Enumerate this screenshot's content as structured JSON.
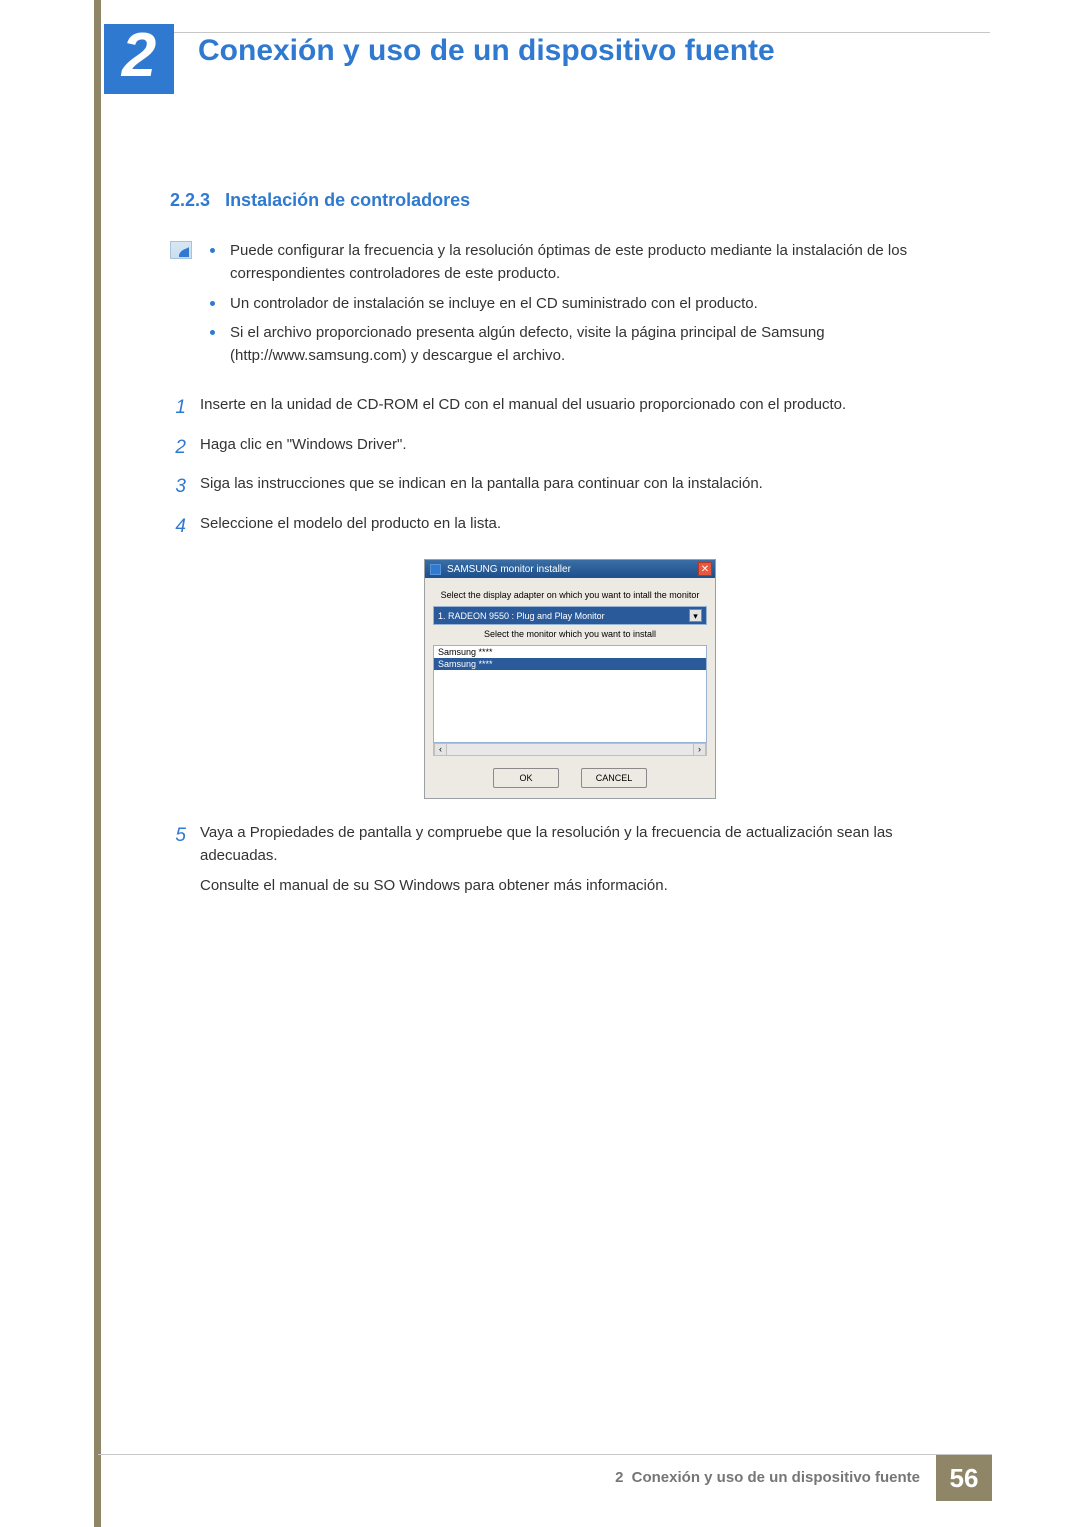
{
  "chapter": {
    "number": "2",
    "title": "Conexión y uso de un dispositivo fuente"
  },
  "section": {
    "number": "2.2.3",
    "title": "Instalación de controladores"
  },
  "notes": [
    "Puede configurar la frecuencia y la resolución óptimas de este producto mediante la instalación de los correspondientes controladores de este producto.",
    "Un controlador de instalación se incluye en el CD suministrado con el producto.",
    "Si el archivo proporcionado presenta algún defecto, visite la página principal de Samsung (http://www.samsung.com) y descargue el archivo."
  ],
  "steps": [
    {
      "n": "1",
      "text": "Inserte en la unidad de CD-ROM el CD con el manual del usuario proporcionado con el producto."
    },
    {
      "n": "2",
      "text": "Haga clic en \"Windows Driver\"."
    },
    {
      "n": "3",
      "text": "Siga las instrucciones que se indican en la pantalla para continuar con la instalación."
    },
    {
      "n": "4",
      "text": "Seleccione el modelo del producto en la lista."
    },
    {
      "n": "5",
      "text": "Vaya a Propiedades de pantalla y compruebe que la resolución y la frecuencia de actualización sean las adecuadas.",
      "extra": "Consulte el manual de su SO Windows para obtener más información."
    }
  ],
  "installer": {
    "title": "SAMSUNG monitor installer",
    "label_adapter": "Select the display adapter on which you want to intall the monitor",
    "adapter_value": "1. RADEON 9550 : Plug and Play Monitor",
    "label_monitor": "Select the monitor which you want to install",
    "list_items": [
      "Samsung ****",
      "Samsung ****"
    ],
    "ok": "OK",
    "cancel": "CANCEL",
    "close_glyph": "✕",
    "caret_glyph": "▾",
    "left_glyph": "‹",
    "right_glyph": "›"
  },
  "footer": {
    "chapter_label": "2",
    "chapter_title": "Conexión y uso de un dispositivo fuente",
    "page": "56"
  }
}
